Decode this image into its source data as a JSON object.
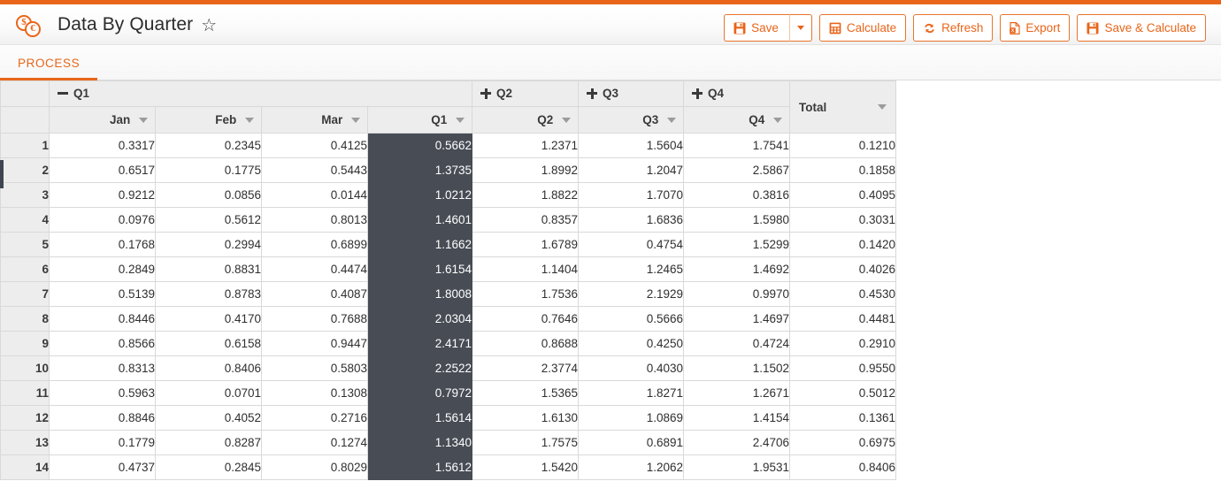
{
  "header": {
    "title": "Data By Quarter",
    "logo_icon": "dollar-euro-coins-icon",
    "favorite_icon": "star-outline-icon",
    "star_glyph": "☆",
    "accent_color": "#e8651a"
  },
  "toolbar": {
    "buttons": [
      {
        "label": "Save",
        "icon": "save-disk-icon"
      },
      {
        "label": "",
        "icon": "chevron-down-icon"
      },
      {
        "label": "Calculate",
        "icon": "calculator-icon"
      },
      {
        "label": "Refresh",
        "icon": "refresh-icon"
      },
      {
        "label": "Export",
        "icon": "excel-export-icon"
      },
      {
        "label": "Save & Calculate",
        "icon": "save-disk-icon"
      }
    ]
  },
  "tabs": [
    {
      "label": "PROCESS",
      "active": true
    }
  ],
  "grid": {
    "groups": [
      {
        "label": "Q1",
        "state": "expanded",
        "toggle_icon": "minus-icon",
        "span": 4
      },
      {
        "label": "Q2",
        "state": "collapsed",
        "toggle_icon": "plus-icon",
        "span": 1
      },
      {
        "label": "Q3",
        "state": "collapsed",
        "toggle_icon": "plus-icon",
        "span": 1
      },
      {
        "label": "Q4",
        "state": "collapsed",
        "toggle_icon": "plus-icon",
        "span": 1
      }
    ],
    "total_header": "Total",
    "columns": [
      "Jan",
      "Feb",
      "Mar",
      "Q1",
      "Q2",
      "Q3",
      "Q4"
    ],
    "filter_icon": "filter-triangle-icon",
    "calculated_column_index": 3,
    "rows": [
      {
        "num": "1",
        "cells": [
          "0.3317",
          "0.2345",
          "0.4125",
          "0.5662",
          "1.2371",
          "1.5604",
          "1.7541"
        ],
        "total": "0.1210"
      },
      {
        "num": "2",
        "cells": [
          "0.6517",
          "0.1775",
          "0.5443",
          "1.3735",
          "1.8992",
          "1.2047",
          "2.5867"
        ],
        "total": "0.1858"
      },
      {
        "num": "3",
        "cells": [
          "0.9212",
          "0.0856",
          "0.0144",
          "1.0212",
          "1.8822",
          "1.7070",
          "0.3816"
        ],
        "total": "0.4095"
      },
      {
        "num": "4",
        "cells": [
          "0.0976",
          "0.5612",
          "0.8013",
          "1.4601",
          "0.8357",
          "1.6836",
          "1.5980"
        ],
        "total": "0.3031"
      },
      {
        "num": "5",
        "cells": [
          "0.1768",
          "0.2994",
          "0.6899",
          "1.1662",
          "1.6789",
          "0.4754",
          "1.5299"
        ],
        "total": "0.1420"
      },
      {
        "num": "6",
        "cells": [
          "0.2849",
          "0.8831",
          "0.4474",
          "1.6154",
          "1.1404",
          "1.2465",
          "1.4692"
        ],
        "total": "0.4026"
      },
      {
        "num": "7",
        "cells": [
          "0.5139",
          "0.8783",
          "0.4087",
          "1.8008",
          "1.7536",
          "2.1929",
          "0.9970"
        ],
        "total": "0.4530"
      },
      {
        "num": "8",
        "cells": [
          "0.8446",
          "0.4170",
          "0.7688",
          "2.0304",
          "0.7646",
          "0.5666",
          "1.4697"
        ],
        "total": "0.4481"
      },
      {
        "num": "9",
        "cells": [
          "0.8566",
          "0.6158",
          "0.9447",
          "2.4171",
          "0.8688",
          "0.4250",
          "0.4724"
        ],
        "total": "0.2910"
      },
      {
        "num": "10",
        "cells": [
          "0.8313",
          "0.8406",
          "0.5803",
          "2.2522",
          "2.3774",
          "0.4030",
          "1.1502"
        ],
        "total": "0.9550"
      },
      {
        "num": "11",
        "cells": [
          "0.5963",
          "0.0701",
          "0.1308",
          "0.7972",
          "1.5365",
          "1.8271",
          "1.2671"
        ],
        "total": "0.5012"
      },
      {
        "num": "12",
        "cells": [
          "0.8846",
          "0.4052",
          "0.2716",
          "1.5614",
          "1.6130",
          "1.0869",
          "1.4154"
        ],
        "total": "0.1361"
      },
      {
        "num": "13",
        "cells": [
          "0.1779",
          "0.8287",
          "0.1274",
          "1.1340",
          "1.7575",
          "0.6891",
          "2.4706"
        ],
        "total": "0.6975"
      },
      {
        "num": "14",
        "cells": [
          "0.4737",
          "0.2845",
          "0.8029",
          "1.5612",
          "1.5420",
          "1.2062",
          "1.9531"
        ],
        "total": "0.8406"
      }
    ]
  }
}
